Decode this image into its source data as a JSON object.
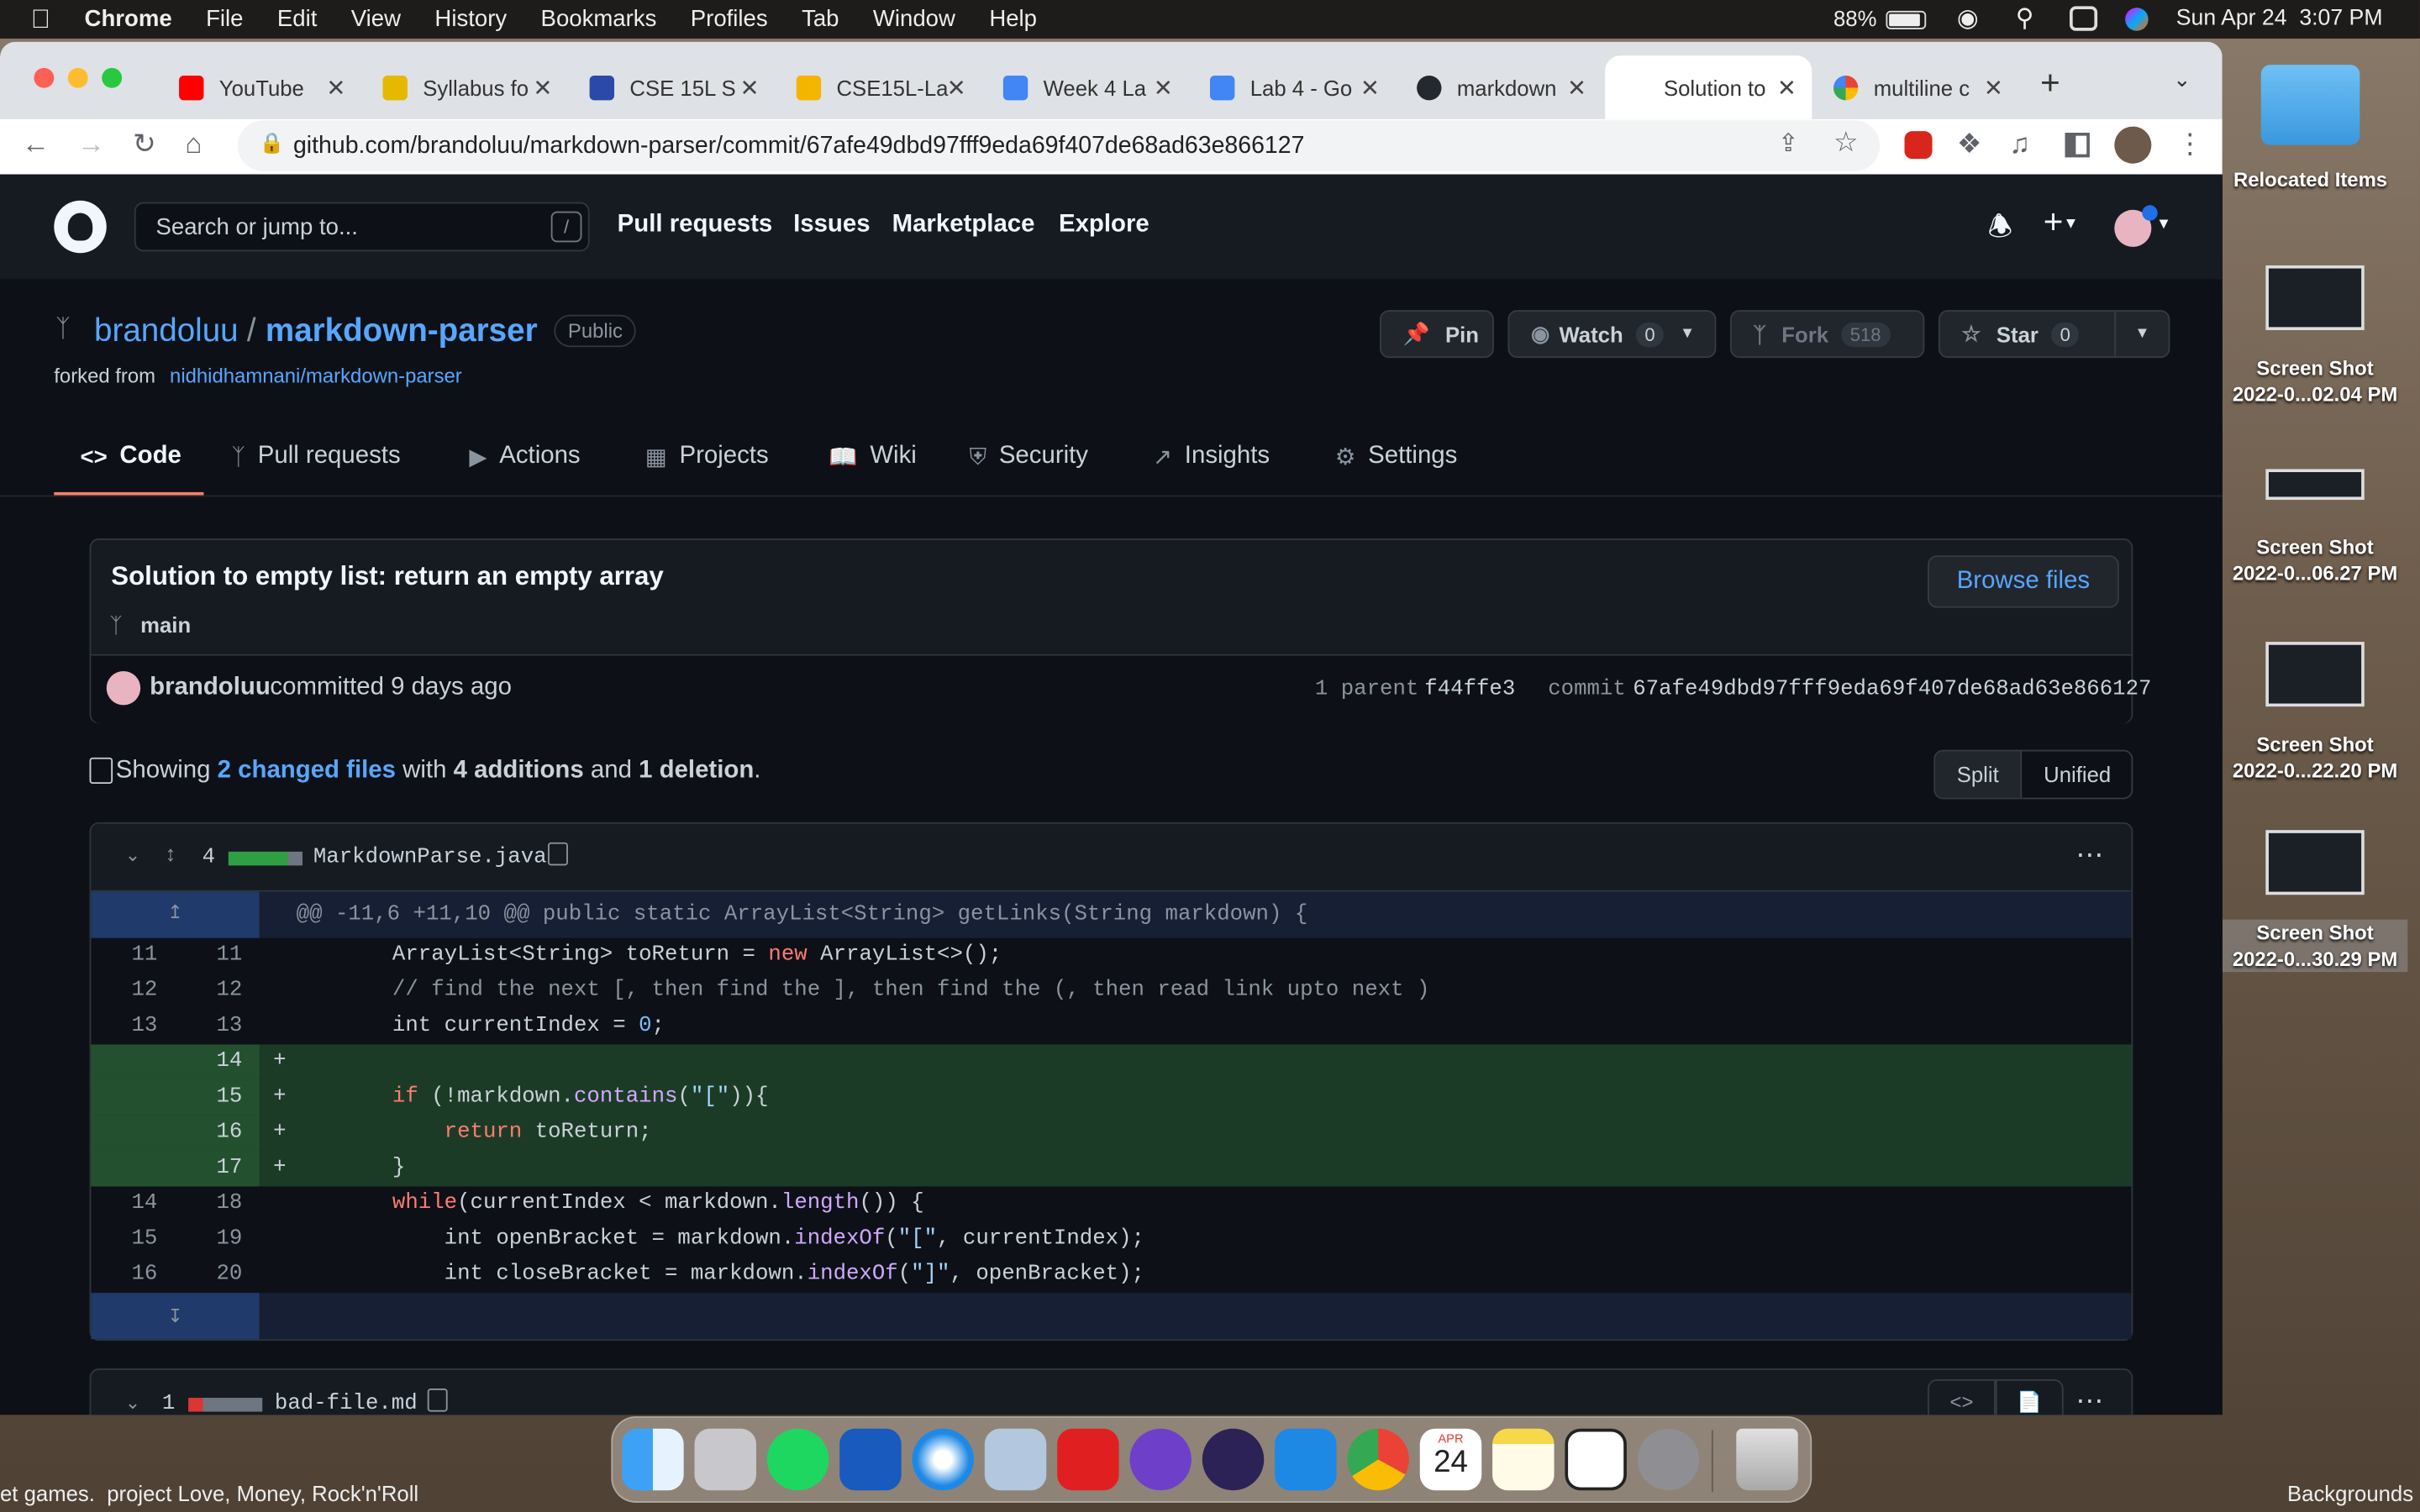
{
  "menubar": {
    "app": "Chrome",
    "items": [
      "File",
      "Edit",
      "View",
      "History",
      "Bookmarks",
      "Profiles",
      "Tab",
      "Window",
      "Help"
    ],
    "battery": "88%",
    "datetime": "Sun Apr 24  3:07 PM"
  },
  "tabs": [
    {
      "label": "YouTube",
      "color": "#ff0000"
    },
    {
      "label": "Syllabus fo",
      "color": "#e6b800"
    },
    {
      "label": "CSE 15L S",
      "color": "#2b4aa8"
    },
    {
      "label": "CSE15L-La",
      "color": "#f4b400"
    },
    {
      "label": "Week 4 La",
      "color": "#4285f4"
    },
    {
      "label": "Lab 4 - Go",
      "color": "#4285f4"
    },
    {
      "label": "markdown",
      "color": "#24292f"
    },
    {
      "label": "Solution to",
      "color": "#ffffff",
      "active": true
    },
    {
      "label": "multiline c",
      "color": "#4285f4"
    }
  ],
  "address": {
    "url": "github.com/brandoluu/markdown-parser/commit/67afe49dbd97fff9eda69f407de68ad63e866127"
  },
  "github": {
    "search_placeholder": "Search or jump to...",
    "search_key": "/",
    "nav": [
      "Pull requests",
      "Issues",
      "Marketplace",
      "Explore"
    ],
    "owner": "brandoluu",
    "separator": "/",
    "repo": "markdown-parser",
    "visibility": "Public",
    "forked_prefix": "forked from",
    "forked_from": "nidhidhamnani/markdown-parser",
    "pin": "Pin",
    "watch": "Watch",
    "watch_count": "0",
    "fork": "Fork",
    "fork_count": "518",
    "star": "Star",
    "star_count": "0",
    "repo_tabs": [
      "Code",
      "Pull requests",
      "Actions",
      "Projects",
      "Wiki",
      "Security",
      "Insights",
      "Settings"
    ],
    "commit_title": "Solution to empty list: return an empty array",
    "browse_files": "Browse files",
    "branch": "main",
    "author": "brandoluu",
    "committed": "committed 9 days ago",
    "parent_label": "1 parent",
    "parent_sha": "f44ffe3",
    "commit_label": "commit",
    "commit_sha": "67afe49dbd97fff9eda69f407de68ad63e866127",
    "showing": "Showing",
    "changed_files": "2 changed files",
    "with": "with",
    "additions": "4 additions",
    "and": "and",
    "deletions": "1 deletion",
    "period": ".",
    "split": "Split",
    "unified": "Unified",
    "file1": {
      "count": "4",
      "name": "MarkdownParse.java"
    },
    "hunk": "@@ -11,6 +11,10 @@ public static ArrayList<String> getLinks(String markdown) {",
    "lines": [
      {
        "old": "11",
        "new": "11",
        "type": "ctx"
      },
      {
        "old": "12",
        "new": "12",
        "type": "ctx"
      },
      {
        "old": "13",
        "new": "13",
        "type": "ctx"
      },
      {
        "old": "",
        "new": "14",
        "type": "add"
      },
      {
        "old": "",
        "new": "15",
        "type": "add"
      },
      {
        "old": "",
        "new": "16",
        "type": "add"
      },
      {
        "old": "",
        "new": "17",
        "type": "add"
      },
      {
        "old": "14",
        "new": "18",
        "type": "ctx"
      },
      {
        "old": "15",
        "new": "19",
        "type": "ctx"
      },
      {
        "old": "16",
        "new": "20",
        "type": "ctx"
      }
    ],
    "file2": {
      "count": "1",
      "name": "bad-file.md"
    }
  },
  "desktop": {
    "folder": "Relocated Items",
    "shots": [
      {
        "l1": "Screen Shot",
        "l2": "2022-0...02.04 PM"
      },
      {
        "l1": "Screen Shot",
        "l2": "2022-0...06.27 PM"
      },
      {
        "l1": "Screen Shot",
        "l2": "2022-0...22.20 PM"
      },
      {
        "l1": "Screen Shot",
        "l2": "2022-0...30.29 PM"
      }
    ],
    "bottom_left": "et games.  project Love, Money, Rock'n'Roll",
    "bottom_right": "Backgrounds ar",
    "calendar_month": "APR",
    "calendar_day": "24"
  }
}
